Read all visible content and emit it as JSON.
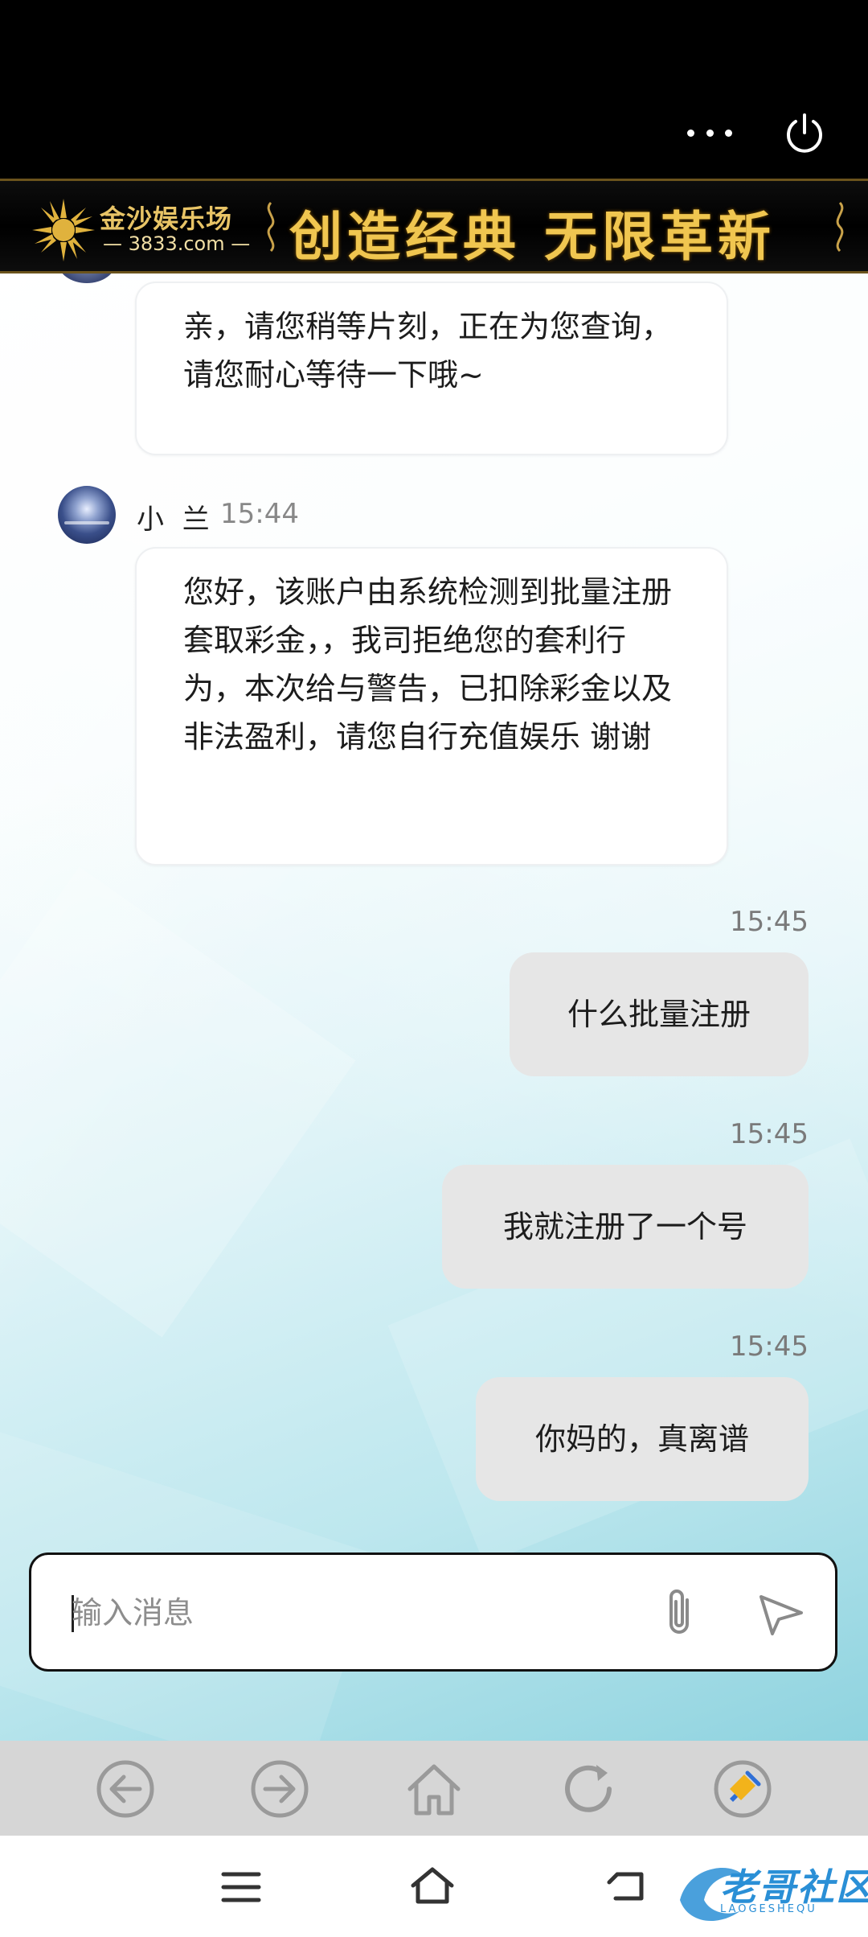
{
  "banner": {
    "logo_name": "金沙娱乐场",
    "logo_site": "— 3833.com —",
    "slogan": "创造经典 无限革新"
  },
  "messages": {
    "first_bubble": "亲，请您稍等片刻，正在为您查询，请您耐心等待一下哦~",
    "agent_name": "小 兰",
    "agent_time": "15:44",
    "agent_bubble": "您好，该账户由系统检测到批量注册套取彩金，，我司拒绝您的套利行为，本次给与警告，已扣除彩金以及非法盈利，请您自行充值娱乐 谢谢",
    "out1_time": "15:45",
    "out1_text": "什么批量注册",
    "out2_time": "15:45",
    "out2_text": "我就注册了一个号",
    "out3_time": "15:45",
    "out3_text": "你妈的，真离谱"
  },
  "composer": {
    "placeholder": "输入消息"
  },
  "watermark": {
    "text": "老哥社区",
    "sub": "LAOGESHEQU"
  },
  "icons": {
    "top_bar": [
      "more-icon",
      "power-icon"
    ],
    "composer": [
      "paperclip-icon",
      "send-icon"
    ],
    "browser_bar": [
      "back-icon",
      "forward-icon",
      "home-icon",
      "refresh-icon",
      "clean-icon"
    ],
    "system_nav": [
      "menu-icon",
      "home-icon",
      "back-icon"
    ]
  },
  "colors": {
    "banner_gold": "#f0c650",
    "incoming_bubble": "#ffffff",
    "outgoing_bubble": "#e6e6e6",
    "browser_bar": "#d6d6d6",
    "watermark_blue": "#2a8fd6"
  }
}
